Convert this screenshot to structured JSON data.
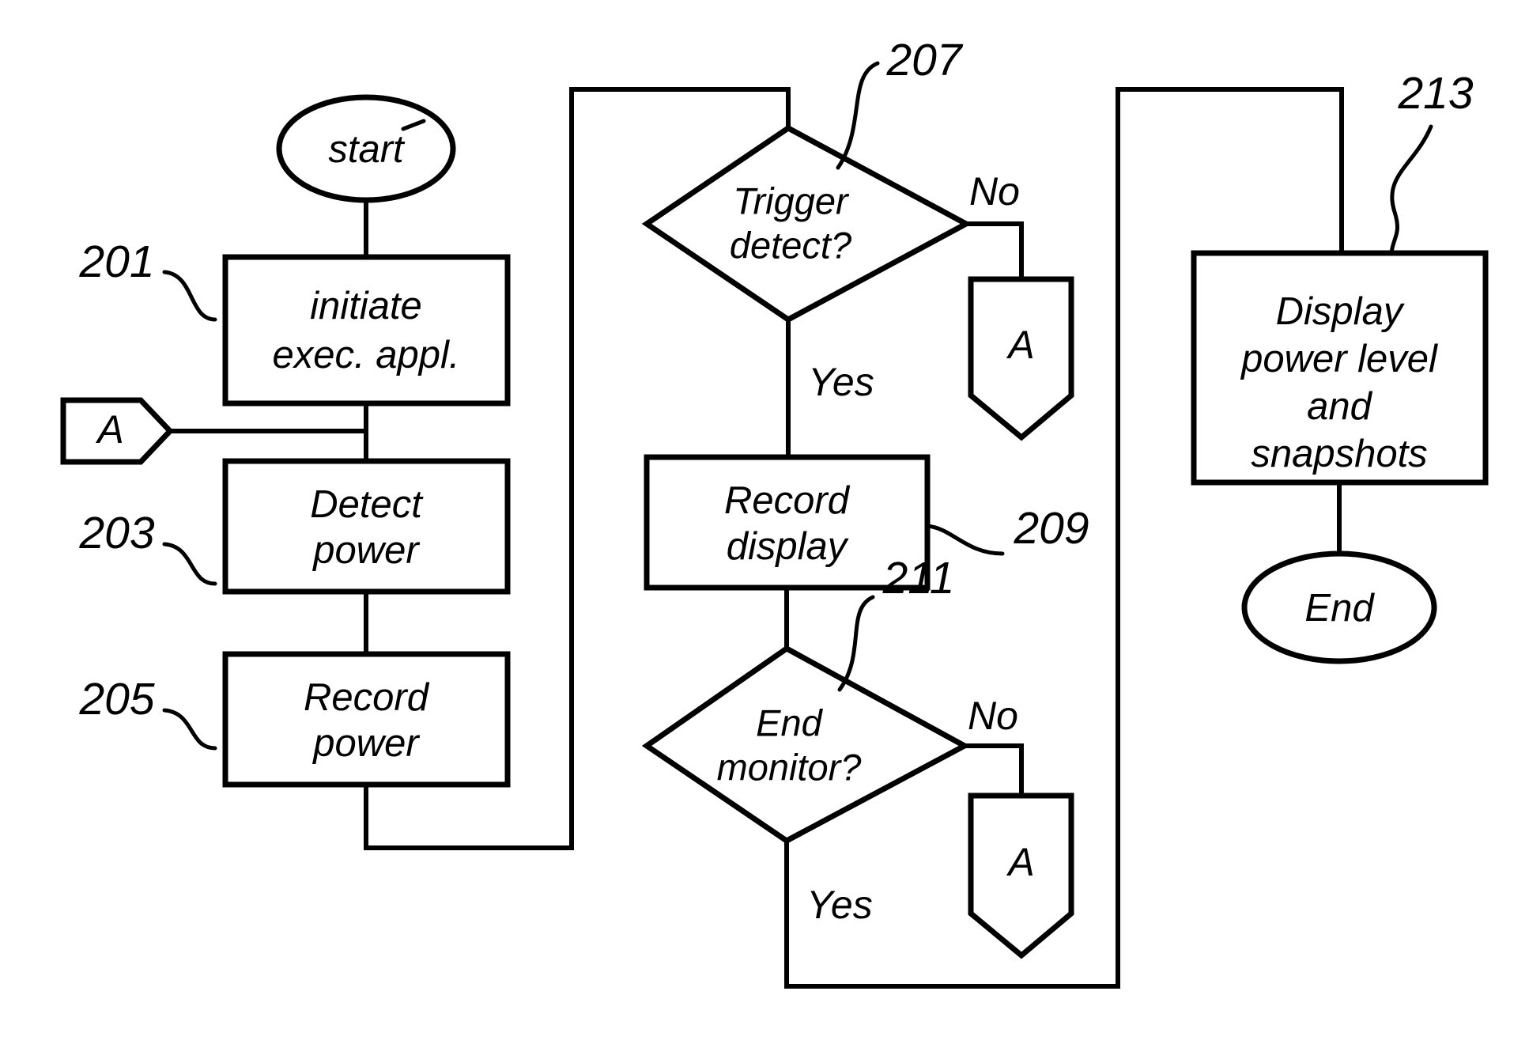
{
  "diagram": {
    "type": "flowchart",
    "nodes": {
      "start": {
        "label": "start",
        "shape": "oval"
      },
      "initiate": {
        "label_line1": "initiate",
        "label_line2": "exec. appl.",
        "shape": "process",
        "ref": "201"
      },
      "connector_in_a": {
        "label": "A",
        "shape": "connector-in"
      },
      "detect_power": {
        "label_line1": "Detect",
        "label_line2": "power",
        "shape": "process",
        "ref": "203"
      },
      "record_power": {
        "label_line1": "Record",
        "label_line2": "power",
        "shape": "process",
        "ref": "205"
      },
      "trigger_detect": {
        "label_line1": "Trigger",
        "label_line2": "detect?",
        "shape": "decision",
        "ref": "207"
      },
      "connector_out_a_top": {
        "label": "A",
        "shape": "connector-out"
      },
      "record_display": {
        "label_line1": "Record",
        "label_line2": "display",
        "shape": "process",
        "ref": "209"
      },
      "end_monitor": {
        "label_line1": "End",
        "label_line2": "monitor?",
        "shape": "decision",
        "ref": "211"
      },
      "connector_out_a_bottom": {
        "label": "A",
        "shape": "connector-out"
      },
      "display_results": {
        "label_line1": "Display",
        "label_line2": "power level",
        "label_line3": "and",
        "label_line4": "snapshots",
        "shape": "process",
        "ref": "213"
      },
      "end": {
        "label": "End",
        "shape": "oval"
      }
    },
    "edge_labels": {
      "trigger_no": "No",
      "trigger_yes": "Yes",
      "end_monitor_no": "No",
      "end_monitor_yes": "Yes"
    },
    "reference_numerals": {
      "n201": "201",
      "n203": "203",
      "n205": "205",
      "n207": "207",
      "n209": "209",
      "n211": "211",
      "n213": "213"
    },
    "colors": {
      "stroke": "#000000",
      "fill": "#ffffff",
      "background": "#ffffff"
    }
  }
}
